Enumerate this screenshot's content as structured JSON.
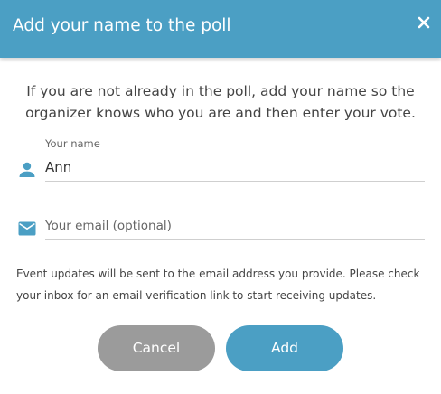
{
  "dialog": {
    "title": "Add your name to the poll",
    "close_icon": "close-icon"
  },
  "intro_text": "If you are not already in the poll, add your name so the organizer knows who you are and then enter your vote.",
  "form": {
    "name_label": "Your name",
    "name_value": "Ann",
    "name_icon": "person-icon",
    "email_placeholder": "Your email (optional)",
    "email_value": "",
    "email_icon": "envelope-icon"
  },
  "note_text": "Event updates will be sent to the email address you provide. Please check your inbox for an email verification link to start receiving updates.",
  "buttons": {
    "cancel_label": "Cancel",
    "add_label": "Add"
  },
  "colors": {
    "header_bg": "#4b9fc4",
    "primary_button": "#4b9fc4",
    "cancel_button": "#9b9b9b",
    "icon": "#4b9fc4"
  }
}
